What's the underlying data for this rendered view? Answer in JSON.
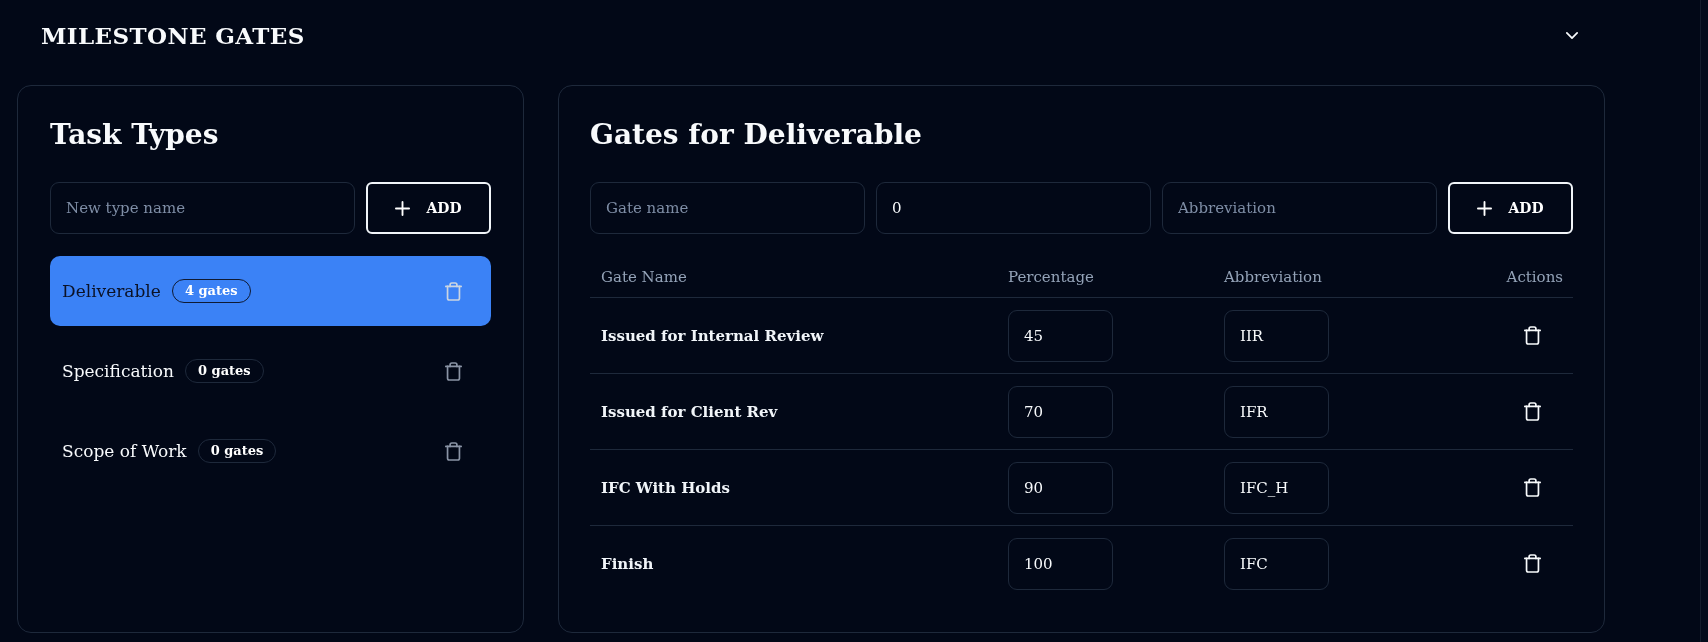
{
  "section": {
    "title": "MILESTONE GATES",
    "expanded": true
  },
  "task_types": {
    "title": "Task Types",
    "new_type": {
      "placeholder": "New type name"
    },
    "add_button": {
      "label": "ADD"
    },
    "items": [
      {
        "name": "Deliverable",
        "badge": "4 gates",
        "selected": true
      },
      {
        "name": "Specification",
        "badge": "0 gates",
        "selected": false
      },
      {
        "name": "Scope of Work",
        "badge": "0 gates",
        "selected": false
      }
    ]
  },
  "gates": {
    "title": "Gates for Deliverable",
    "new_gate": {
      "name": {
        "placeholder": "Gate name"
      },
      "percentage": {
        "value": "0"
      },
      "abbreviation": {
        "placeholder": "Abbreviation"
      }
    },
    "add_button": {
      "label": "ADD"
    },
    "table": {
      "columns": [
        "Gate Name",
        "Percentage",
        "Abbreviation",
        "Actions"
      ],
      "rows": [
        {
          "gate_name": "Issued for Internal Review",
          "percentage": "45",
          "abbreviation": "IIR"
        },
        {
          "gate_name": "Issued for Client Rev",
          "percentage": "70",
          "abbreviation": "IFR"
        },
        {
          "gate_name": "IFC With Holds",
          "percentage": "90",
          "abbreviation": "IFC_H"
        },
        {
          "gate_name": "Finish",
          "percentage": "100",
          "abbreviation": "IFC"
        }
      ]
    }
  }
}
